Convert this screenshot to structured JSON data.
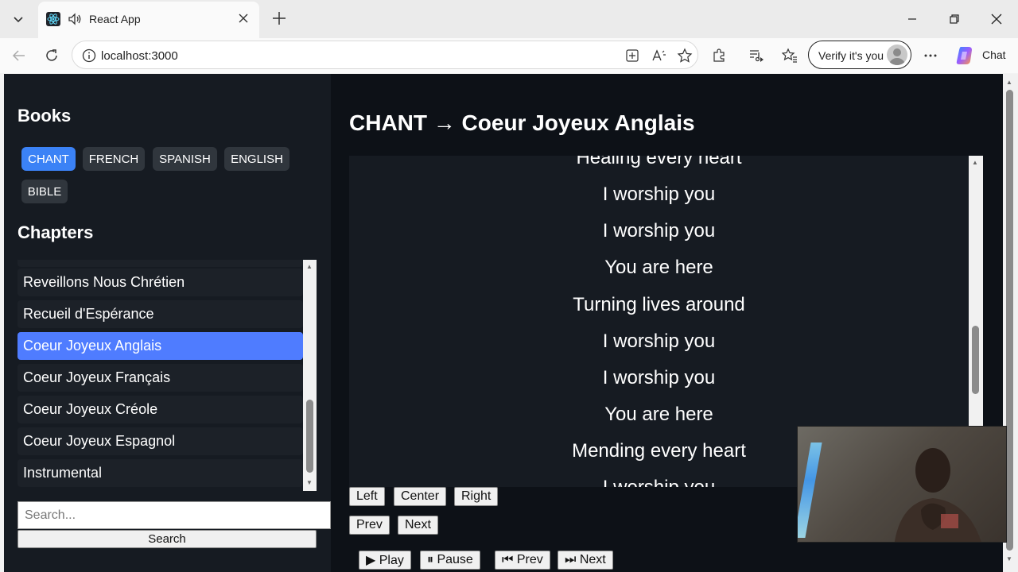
{
  "browser": {
    "tab_title": "React App",
    "url": "localhost:3000",
    "profile_label": "Verify it's you",
    "copilot_label": "Chat"
  },
  "sidebar": {
    "books_heading": "Books",
    "books": [
      {
        "label": "CHANT",
        "active": true
      },
      {
        "label": "FRENCH",
        "active": false
      },
      {
        "label": "SPANISH",
        "active": false
      },
      {
        "label": "ENGLISH",
        "active": false
      },
      {
        "label": "BIBLE",
        "active": false
      }
    ],
    "chapters_heading": "Chapters",
    "chapters": [
      {
        "label": "Reveillons Nous Chrétien",
        "active": false
      },
      {
        "label": "Recueil d'Espérance",
        "active": false
      },
      {
        "label": "Coeur Joyeux Anglais",
        "active": true
      },
      {
        "label": "Coeur Joyeux Français",
        "active": false
      },
      {
        "label": "Coeur Joyeux Créole",
        "active": false
      },
      {
        "label": "Coeur Joyeux Espagnol",
        "active": false
      },
      {
        "label": "Instrumental",
        "active": false
      }
    ],
    "search_placeholder": "Search...",
    "search_button": "Search"
  },
  "main": {
    "title": "CHANT → Coeur Joyeux Anglais",
    "lyrics": [
      "Healing every heart",
      "I worship you",
      "I worship you",
      "You are here",
      "Turning lives around",
      "I worship you",
      "I worship you",
      "You are here",
      "Mending every heart",
      "I worship you"
    ],
    "align_buttons": [
      "Left",
      "Center",
      "Right"
    ],
    "nav_buttons": [
      "Prev",
      "Next"
    ],
    "playback_buttons": [
      "▶ Play",
      "⏸ Pause",
      "⏮ Prev",
      "⏭ Next"
    ]
  },
  "colors": {
    "page_bg": "#0d1117",
    "sidebar_bg": "#161b22",
    "active_book": "#3b82f6",
    "active_chapter": "#4f7cff"
  }
}
